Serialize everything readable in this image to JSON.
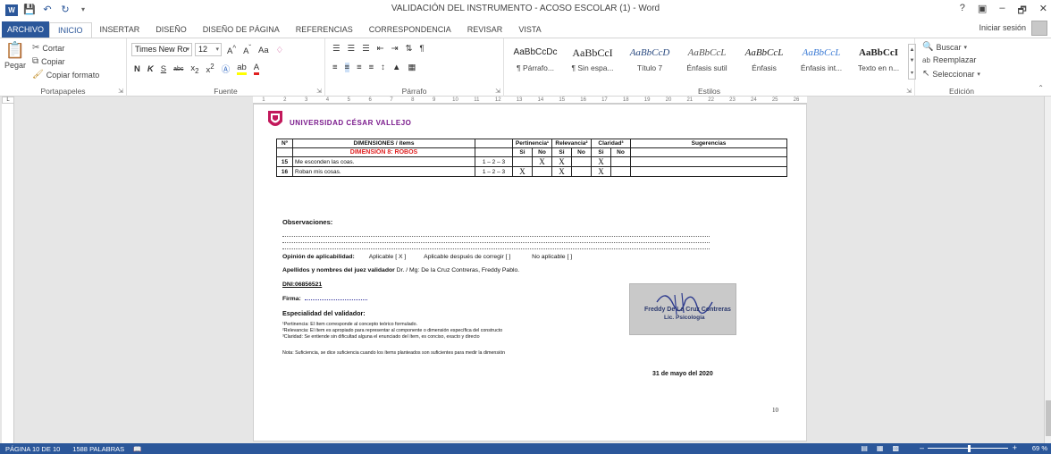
{
  "titlebar": {
    "title": "VALIDACIÓN DEL INSTRUMENTO - ACOSO ESCOLAR (1) - Word",
    "help": "?",
    "minimize": "–",
    "restore": "🗗",
    "close": "✕"
  },
  "tabs": {
    "file": "ARCHIVO",
    "items": [
      "INICIO",
      "INSERTAR",
      "DISEÑO",
      "DISEÑO DE PÁGINA",
      "REFERENCIAS",
      "CORRESPONDENCIA",
      "REVISAR",
      "VISTA"
    ],
    "signin": "Iniciar sesión"
  },
  "ribbon": {
    "clipboard": {
      "paste": "Pegar",
      "cut": "Cortar",
      "copy": "Copiar",
      "format_painter": "Copiar formato",
      "label": "Portapapeles"
    },
    "font": {
      "family": "Times New Ro",
      "size": "12",
      "label": "Fuente",
      "aa": "Aa"
    },
    "paragraph": {
      "label": "Párrafo"
    },
    "styles": {
      "label": "Estilos",
      "items": [
        {
          "sample": "AaBbCcDc",
          "name": "¶ Párrafo..."
        },
        {
          "sample": "AaBbCcI",
          "name": "¶ Sin espa..."
        },
        {
          "sample": "AaBbCcD",
          "name": "Título 7"
        },
        {
          "sample": "AaBbCcL",
          "name": "Énfasis sutil"
        },
        {
          "sample": "AaBbCcL",
          "name": "Énfasis"
        },
        {
          "sample": "AaBbCcL",
          "name": "Énfasis int..."
        },
        {
          "sample": "AaBbCcI",
          "name": "Texto en n..."
        }
      ]
    },
    "editing": {
      "label": "Edición",
      "find": "Buscar",
      "replace": "Reemplazar",
      "select": "Seleccionar"
    }
  },
  "ruler": [
    "1",
    "2",
    "3",
    "4",
    "5",
    "6",
    "7",
    "8",
    "9",
    "10",
    "11",
    "12",
    "13",
    "14",
    "15",
    "16",
    "17",
    "18",
    "19",
    "20",
    "21",
    "22",
    "23",
    "24",
    "25",
    "26"
  ],
  "document": {
    "university": "UNIVERSIDAD CÉSAR VALLEJO",
    "table": {
      "h_num": "Nº",
      "h_dim": "DIMENSIONES / ítems",
      "h_pert": "Pertinencia¹",
      "h_rel": "Relevancia²",
      "h_cla": "Claridad³",
      "h_sug": "Sugerencias",
      "si": "Si",
      "no": "No",
      "dimension": "DIMENSIÓN 8: ROBOS",
      "rows": [
        {
          "num": "15",
          "item": "Me esconden las coas.",
          "scale": "1 – 2 – 3",
          "p_si": "",
          "p_no": "X",
          "r_si": "X",
          "r_no": "",
          "c_si": "X",
          "c_no": ""
        },
        {
          "num": "16",
          "item": "Roban mis cosas.",
          "scale": "1 – 2 – 3",
          "p_si": "X",
          "p_no": "",
          "r_si": "X",
          "r_no": "",
          "c_si": "X",
          "c_no": ""
        }
      ]
    },
    "observaciones": "Observaciones:",
    "opinion_label": "Opinión de aplicabilidad:",
    "opinion_aplicable": "Aplicable [ X ]",
    "opinion_despues": "Aplicable después de corregir [   ]",
    "opinion_no": "No aplicable [   ]",
    "juez_label": "Apellidos y nombres del juez validador",
    "juez_name": "Dr. / Mg: De la Cruz Contreras, Freddy Pablo.",
    "dni": "DNI:06856521",
    "firma": "Firma:",
    "especialidad": "Especialidad del validador:",
    "nota1": "¹Pertinencia: El ítem corresponde al concepto teórico formulado.",
    "nota2": "²Relevancia: El ítem es apropiado para representar al componente o dimensión específica del constructo",
    "nota3": "³Claridad: Se entiende sin dificultad alguna el enunciado del ítem, es conciso, exacto y directo",
    "nota_suf": "Nota: Suficiencia, se dice suficiencia cuando los ítems planteados son suficientes para medir la dimensión",
    "signature_name": "Freddy De La Cruz Contreras",
    "signature_title": "Lic. Psicología",
    "date": "31 de mayo del 2020",
    "page_number": "10"
  },
  "status": {
    "page": "PÁGINA 10 DE 10",
    "words": "1588 PALABRAS",
    "zoom": "69 %"
  },
  "colors": {
    "word_blue": "#2b579a",
    "dimension_red": "#e02020",
    "university_purple": "#7a1a8c"
  }
}
